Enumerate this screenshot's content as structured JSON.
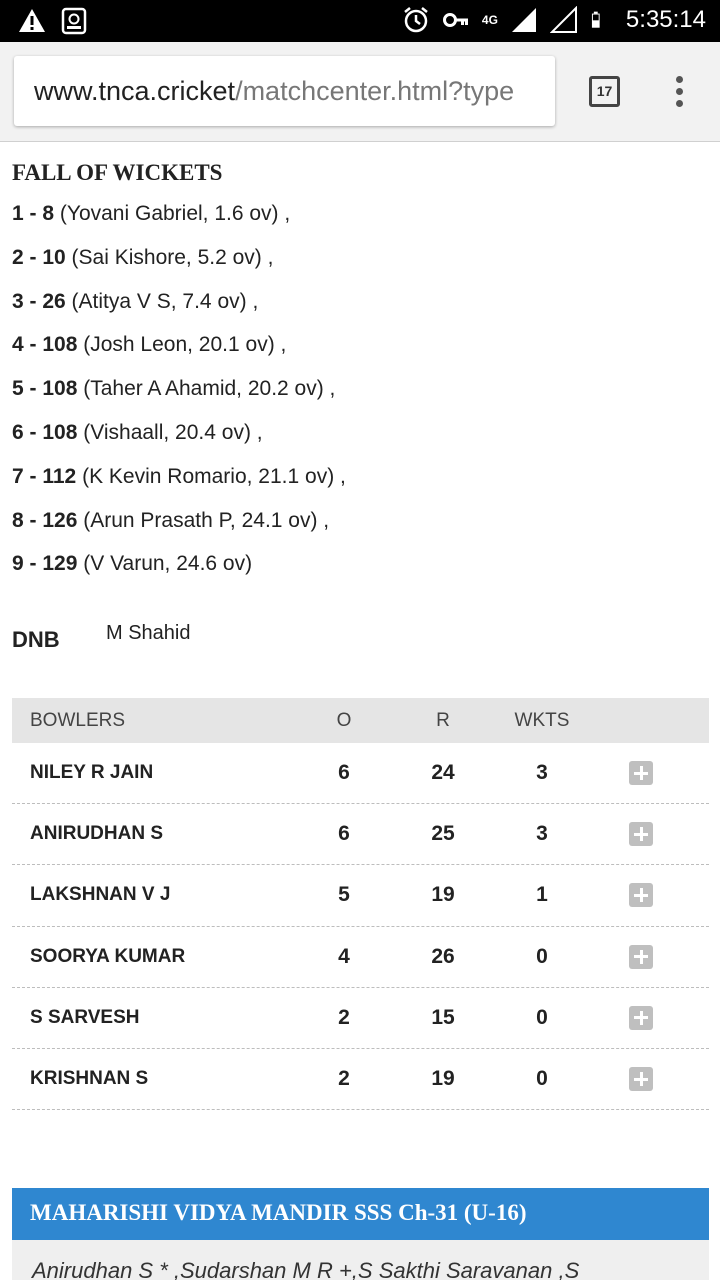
{
  "status_bar": {
    "time": "5:35:14",
    "network": "4G",
    "icons": [
      "warning-icon",
      "sim-icon",
      "alarm-icon",
      "key-icon",
      "signal-icon",
      "signal-empty-icon",
      "battery-icon"
    ]
  },
  "browser": {
    "url_domain": "www.tnca.cricket",
    "url_path": "/matchcenter.html?type",
    "tab_count": "17"
  },
  "fall_of_wickets": {
    "title": "FALL OF WICKETS",
    "items": [
      {
        "score": "1 - 8",
        "detail": "(Yovani Gabriel, 1.6 ov) ,"
      },
      {
        "score": "2 - 10",
        "detail": "(Sai Kishore, 5.2 ov) ,"
      },
      {
        "score": "3 - 26",
        "detail": "(Atitya V S, 7.4 ov) ,"
      },
      {
        "score": "4 - 108",
        "detail": "(Josh Leon, 20.1 ov) ,"
      },
      {
        "score": "5 - 108",
        "detail": "(Taher A Ahamid, 20.2 ov) ,"
      },
      {
        "score": "6 - 108",
        "detail": "(Vishaall, 20.4 ov) ,"
      },
      {
        "score": "7 - 112",
        "detail": "(K Kevin Romario, 21.1 ov) ,"
      },
      {
        "score": "8 - 126",
        "detail": "(Arun Prasath P, 24.1 ov) ,"
      },
      {
        "score": "9 - 129",
        "detail": "(V Varun, 24.6 ov)"
      }
    ]
  },
  "dnb": {
    "label": "DNB",
    "value": "M Shahid"
  },
  "bowlers": {
    "headers": {
      "name": "BOWLERS",
      "overs": "O",
      "runs": "R",
      "wickets": "WKTS"
    },
    "rows": [
      {
        "name": "NILEY R JAIN",
        "overs": "6",
        "runs": "24",
        "wickets": "3"
      },
      {
        "name": "ANIRUDHAN S",
        "overs": "6",
        "runs": "25",
        "wickets": "3"
      },
      {
        "name": "LAKSHNAN V J",
        "overs": "5",
        "runs": "19",
        "wickets": "1"
      },
      {
        "name": "SOORYA KUMAR",
        "overs": "4",
        "runs": "26",
        "wickets": "0"
      },
      {
        "name": "S SARVESH",
        "overs": "2",
        "runs": "15",
        "wickets": "0"
      },
      {
        "name": "KRISHNAN S",
        "overs": "2",
        "runs": "19",
        "wickets": "0"
      }
    ]
  },
  "team": {
    "title": "MAHARISHI VIDYA MANDIR SSS Ch-31 (U-16)",
    "players": "Anirudhan S * ,Sudarshan M R +,S Sakthi Saravanan ,S"
  },
  "colors": {
    "team_bar": "#2f87d0",
    "table_header": "#e5e5e5"
  }
}
